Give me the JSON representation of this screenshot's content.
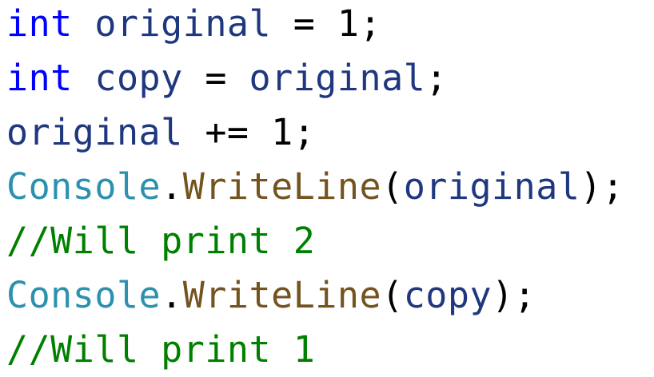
{
  "colors": {
    "keyword": "#0000ff",
    "variable": "#1f377f",
    "operator": "#000000",
    "class": "#2b91af",
    "method": "#74531f",
    "comment": "#008000",
    "background": "#ffffff"
  },
  "code": {
    "line1": {
      "keyword": "int",
      "variable": "original",
      "operator": "=",
      "number": "1",
      "semicolon": ";"
    },
    "line2": {
      "keyword": "int",
      "variable": "copy",
      "operator": "=",
      "value": "original",
      "semicolon": ";"
    },
    "line3": {
      "variable": "original",
      "operator": "+=",
      "number": "1",
      "semicolon": ";"
    },
    "line4": {
      "class": "Console",
      "dot": ".",
      "method": "WriteLine",
      "open_paren": "(",
      "argument": "original",
      "close": ");"
    },
    "line5": {
      "comment": "//Will print 2"
    },
    "line6": {
      "class": "Console",
      "dot": ".",
      "method": "WriteLine",
      "open_paren": "(",
      "argument": "copy",
      "close": ");"
    },
    "line7": {
      "comment": "//Will print 1"
    }
  }
}
